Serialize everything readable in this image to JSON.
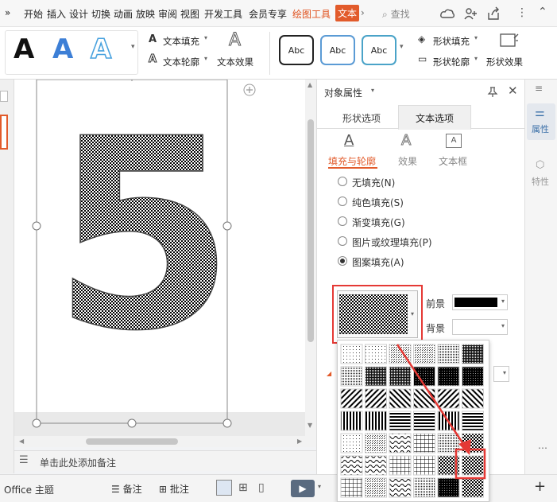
{
  "menu": {
    "overflow": "»",
    "items": [
      "开始",
      "插入",
      "设计",
      "切换",
      "动画",
      "放映",
      "审阅",
      "视图",
      "开发工具",
      "会员专享",
      "绘图工具",
      "文本"
    ],
    "more": "›",
    "search": "查找"
  },
  "ribbon": {
    "text_styles": [
      "A",
      "A",
      "A"
    ],
    "text_fill": "文本填充",
    "text_outline": "文本轮廓",
    "text_effect": "文本效果",
    "shape_styles": [
      "Abc",
      "Abc",
      "Abc"
    ],
    "shape_fill": "形状填充",
    "shape_outline": "形状轮廓",
    "shape_effect": "形状效果"
  },
  "canvas": {
    "numeral": "5"
  },
  "notes": {
    "placeholder": "单击此处添加备注"
  },
  "status": {
    "theme": "Office 主题",
    "notes_btn": "备注",
    "comment_btn": "批注"
  },
  "panel": {
    "title": "对象属性",
    "tabs": [
      "形状选项",
      "文本选项"
    ],
    "subtabs": [
      "填充与轮廓",
      "效果",
      "文本框"
    ],
    "fill_options": [
      "无填充(N)",
      "纯色填充(S)",
      "渐变填充(G)",
      "图片或纹理填充(P)",
      "图案填充(A)"
    ],
    "selected_fill": 4,
    "foreground": "前景",
    "background": "背景"
  },
  "rightbar": {
    "props": "属性",
    "traits": "特性"
  },
  "colors": {
    "accent": "#e25b2b",
    "highlight": "#e53935"
  }
}
